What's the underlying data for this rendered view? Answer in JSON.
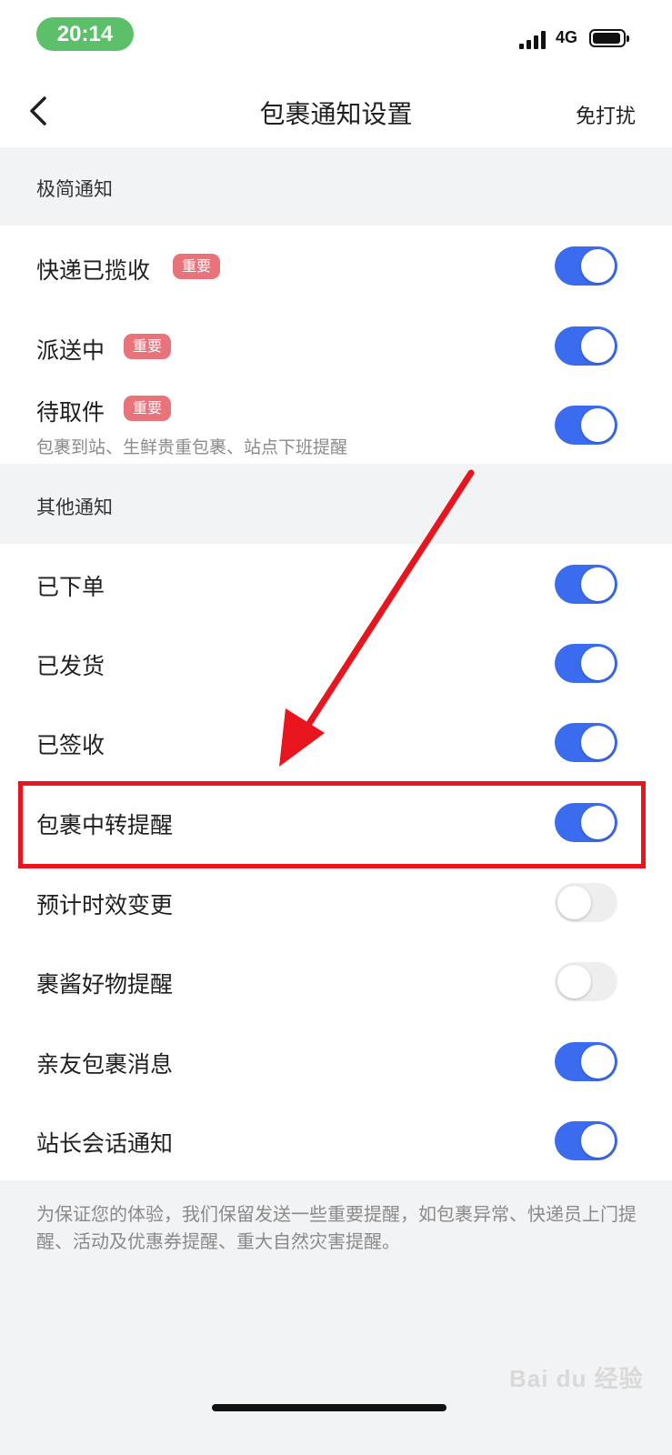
{
  "status_bar": {
    "time": "20:14",
    "network": "4G"
  },
  "nav": {
    "title": "包裹通知设置",
    "right_action": "免打扰"
  },
  "sections": [
    {
      "header": "极简通知",
      "items": [
        {
          "label": "快递已揽收",
          "badge": "重要",
          "enabled": true
        },
        {
          "label": "派送中",
          "badge": "重要",
          "enabled": true
        },
        {
          "label": "待取件",
          "badge": "重要",
          "subtitle": "包裹到站、生鲜贵重包裹、站点下班提醒",
          "enabled": true
        }
      ]
    },
    {
      "header": "其他通知",
      "items": [
        {
          "label": "已下单",
          "enabled": true
        },
        {
          "label": "已发货",
          "enabled": true
        },
        {
          "label": "已签收",
          "enabled": true
        },
        {
          "label": "包裹中转提醒",
          "enabled": true,
          "highlighted": true
        },
        {
          "label": "预计时效变更",
          "enabled": false
        },
        {
          "label": "裹酱好物提醒",
          "enabled": false
        },
        {
          "label": "亲友包裹消息",
          "enabled": true
        },
        {
          "label": "站长会话通知",
          "enabled": true
        }
      ]
    }
  ],
  "footer_note": "为保证您的体验，我们保留发送一些重要提醒，如包裹异常、快递员上门提醒、活动及优惠券提醒、重大自然灾害提醒。",
  "watermark": "Bai du 经验",
  "colors": {
    "toggle_on": "#3b6cf0",
    "toggle_off": "#eeeeee",
    "badge": "#e8737a",
    "annotation": "#e8141e"
  }
}
